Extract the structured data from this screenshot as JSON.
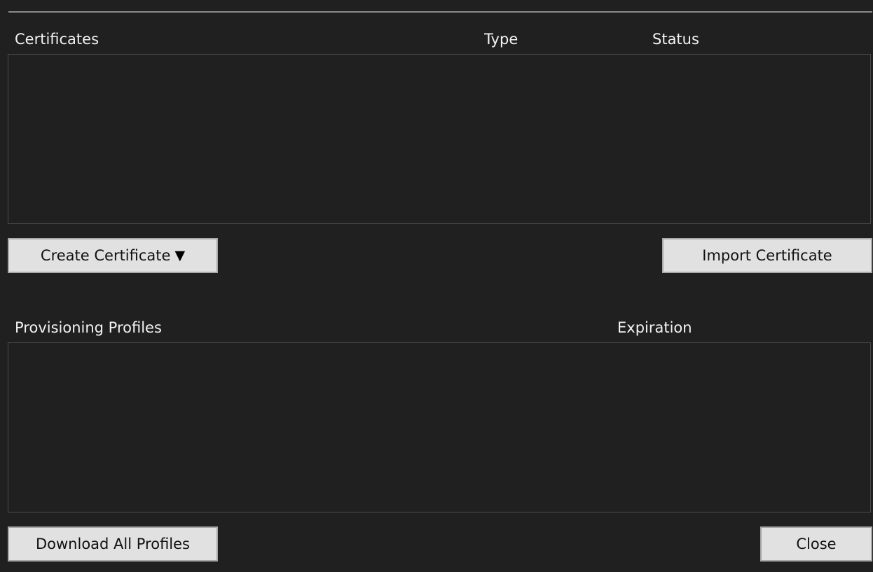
{
  "certificates": {
    "headers": {
      "name": "Certificates",
      "type": "Type",
      "status": "Status"
    },
    "rows": []
  },
  "buttons": {
    "create_certificate": "Create Certificate",
    "create_certificate_arrow": "▼",
    "import_certificate": "Import Certificate",
    "download_all_profiles": "Download All Profiles",
    "close": "Close"
  },
  "provisioning_profiles": {
    "headers": {
      "name": "Provisioning Profiles",
      "expiration": "Expiration"
    },
    "rows": []
  },
  "icons": {
    "dropdown_arrow": "chevron-down-icon"
  },
  "colors": {
    "background": "#202020",
    "text": "#f2f2f2",
    "button_bg": "#e1e1e1",
    "button_border": "#a8a8a8",
    "list_border": "#4a4a4a",
    "divider": "#8a8a8a"
  }
}
